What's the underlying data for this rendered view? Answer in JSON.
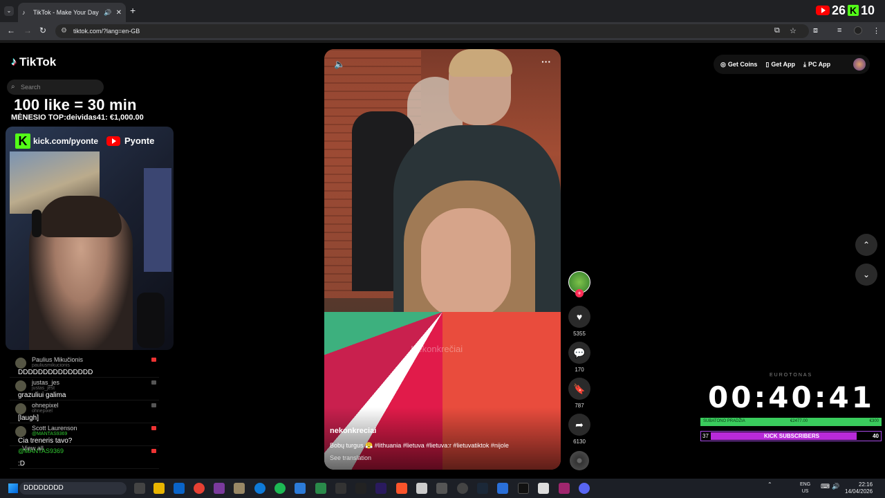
{
  "browser": {
    "tab_title": "TikTok - Make Your Day",
    "url": "tiktok.com/?lang=en-GB"
  },
  "stream_overlay": {
    "yt_count": "26",
    "kick_count": "10",
    "promo": "100 like = 30 min",
    "top_donor": "MĖNESIO TOP:deividas41: €1,000.00",
    "kick_handle": "kick.com/pyonte",
    "yt_handle": "Pyonte"
  },
  "tiktok": {
    "brand": "TikTok",
    "search_placeholder": "Search",
    "header": {
      "coins": "Get Coins",
      "app": "Get App",
      "pc_app": "PC App"
    }
  },
  "chat": {
    "messages": [
      {
        "user": "Paulius Mikučionis",
        "sub": "pauliusmikucionis",
        "text": "DDDDDDDDDDDDDDD"
      },
      {
        "user": "justas_jes",
        "sub": "justas_jest",
        "text": "grazuliui galima"
      },
      {
        "user": "ohnepixel",
        "sub": "ohnepixel",
        "text": "[laugh]"
      },
      {
        "user": "Scott Laurenson",
        "sub": "@MANTAS9369",
        "text": "Cia treneris tavo?"
      },
      {
        "user": "@MANTAS9369",
        "sub": "",
        "text": ":D"
      }
    ],
    "view_all": "View all"
  },
  "video": {
    "author": "nekonkreciai",
    "caption": "Bobų turgus 😤 #lithuania #lietuva #lietuva:r #lietuvatiktok #nijole",
    "see_translation": "See translation",
    "watermark": "Nekonkrečiai",
    "likes": "5355",
    "comments": "170",
    "saves": "787",
    "shares": "6130"
  },
  "subathon": {
    "label": "EUROTONAS",
    "timer": "00:40:41",
    "bar_left": "SUBATONO PRADŽIA",
    "bar_mid": "€2477.00",
    "bar_right": "€300",
    "kick_subs_label": "KICK SUBSCRIBERS",
    "kick_subs_current": "37",
    "kick_subs_goal": "40",
    "kick_subs_progress": 0.925
  },
  "taskbar": {
    "search_text": "DDDDDDDD",
    "lang": "ENG",
    "region": "US",
    "time": "22:16",
    "date": "14/04/2026"
  },
  "colors": {
    "accent_pink": "#fe2c55",
    "kick_green": "#53fc18",
    "subathon_green": "#3acc5d",
    "kick_purple": "#b82ad9"
  }
}
